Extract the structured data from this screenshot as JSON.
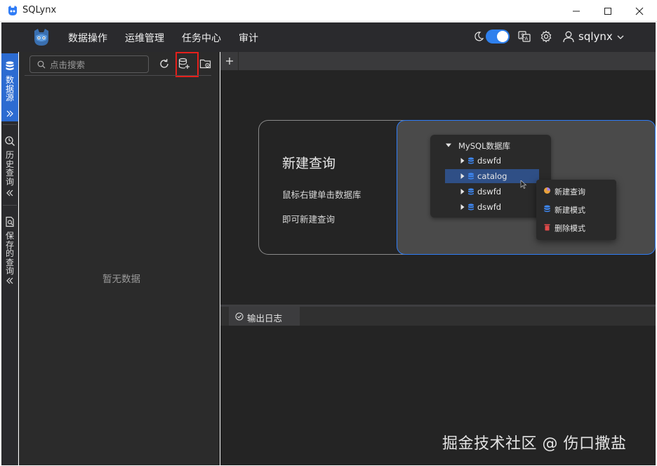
{
  "window": {
    "title": "SQLynx"
  },
  "menubar": {
    "items": [
      {
        "label": "数据操作"
      },
      {
        "label": "运维管理"
      },
      {
        "label": "任务中心"
      },
      {
        "label": "审计"
      }
    ],
    "theme_toggle": {
      "state": "on",
      "color": "#2f80ed"
    },
    "user": {
      "name": "sqlynx"
    }
  },
  "activity_bar": {
    "items": [
      {
        "label": "数据源",
        "icon": "database-icon",
        "active": true
      },
      {
        "label": "历史查询",
        "icon": "history-search-icon",
        "active": false
      },
      {
        "label": "保存的查询",
        "icon": "saved-query-icon",
        "active": false
      }
    ]
  },
  "side_panel": {
    "search": {
      "placeholder": "点击搜索",
      "value": ""
    },
    "empty_text": "暂无数据"
  },
  "editor": {
    "guide": {
      "title": "新建查询",
      "line1": "鼠标右键单击数据库",
      "line2": "即可新建查询",
      "tree": {
        "root": "MySQL数据库",
        "children": [
          "dswfd",
          "catalog",
          "dswfd",
          "dswfd"
        ],
        "selected_index": 1
      },
      "context_menu": [
        {
          "label": "新建查询",
          "icon": "new-query-icon"
        },
        {
          "label": "新建模式",
          "icon": "database-icon"
        },
        {
          "label": "删除模式",
          "icon": "trash-icon"
        }
      ]
    }
  },
  "output": {
    "tab_label": "输出日志"
  },
  "watermark": "掘金技术社区 @ 伤口撒盐",
  "colors": {
    "accent": "#2c6bd1",
    "highlight_border": "#e5201b",
    "guide_border": "#2f7cf6"
  }
}
